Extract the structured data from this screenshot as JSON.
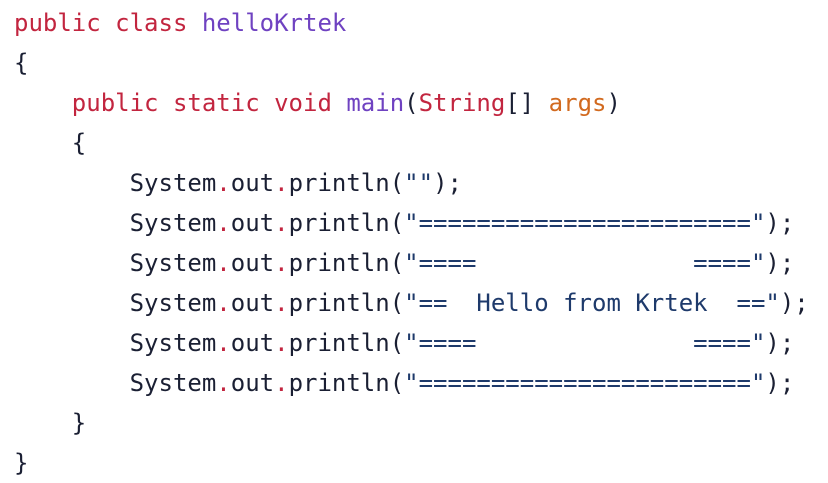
{
  "colors": {
    "background": "#ffffff",
    "keyword": "#c2253f",
    "identifier": "#6f42c1",
    "parameter": "#d26a1f",
    "text": "#1a1f33",
    "string": "#1e3a6b"
  },
  "code": {
    "language": "java",
    "lines": [
      [
        {
          "t": "keyword",
          "v": "public"
        },
        {
          "t": "plain",
          "v": " "
        },
        {
          "t": "keyword",
          "v": "class"
        },
        {
          "t": "plain",
          "v": " "
        },
        {
          "t": "classname",
          "v": "helloKrtek"
        }
      ],
      [
        {
          "t": "punct",
          "v": "{"
        }
      ],
      [
        {
          "t": "plain",
          "v": "    "
        },
        {
          "t": "keyword",
          "v": "public"
        },
        {
          "t": "plain",
          "v": " "
        },
        {
          "t": "keyword",
          "v": "static"
        },
        {
          "t": "plain",
          "v": " "
        },
        {
          "t": "keyword",
          "v": "void"
        },
        {
          "t": "plain",
          "v": " "
        },
        {
          "t": "method",
          "v": "main"
        },
        {
          "t": "punct",
          "v": "("
        },
        {
          "t": "type",
          "v": "String"
        },
        {
          "t": "punct",
          "v": "[] "
        },
        {
          "t": "param",
          "v": "args"
        },
        {
          "t": "punct",
          "v": ")"
        }
      ],
      [
        {
          "t": "plain",
          "v": "    "
        },
        {
          "t": "punct",
          "v": "{"
        }
      ],
      [
        {
          "t": "plain",
          "v": "        System"
        },
        {
          "t": "dot",
          "v": "."
        },
        {
          "t": "plain",
          "v": "out"
        },
        {
          "t": "dot",
          "v": "."
        },
        {
          "t": "plain",
          "v": "println("
        },
        {
          "t": "string",
          "v": "\"\""
        },
        {
          "t": "plain",
          "v": ");"
        }
      ],
      [
        {
          "t": "plain",
          "v": "        System"
        },
        {
          "t": "dot",
          "v": "."
        },
        {
          "t": "plain",
          "v": "out"
        },
        {
          "t": "dot",
          "v": "."
        },
        {
          "t": "plain",
          "v": "println("
        },
        {
          "t": "string",
          "v": "\"=======================\""
        },
        {
          "t": "plain",
          "v": ");"
        }
      ],
      [
        {
          "t": "plain",
          "v": "        System"
        },
        {
          "t": "dot",
          "v": "."
        },
        {
          "t": "plain",
          "v": "out"
        },
        {
          "t": "dot",
          "v": "."
        },
        {
          "t": "plain",
          "v": "println("
        },
        {
          "t": "string",
          "v": "\"====               ====\""
        },
        {
          "t": "plain",
          "v": ");"
        }
      ],
      [
        {
          "t": "plain",
          "v": "        System"
        },
        {
          "t": "dot",
          "v": "."
        },
        {
          "t": "plain",
          "v": "out"
        },
        {
          "t": "dot",
          "v": "."
        },
        {
          "t": "plain",
          "v": "println("
        },
        {
          "t": "string",
          "v": "\"==  Hello from Krtek  ==\""
        },
        {
          "t": "plain",
          "v": ");"
        }
      ],
      [
        {
          "t": "plain",
          "v": "        System"
        },
        {
          "t": "dot",
          "v": "."
        },
        {
          "t": "plain",
          "v": "out"
        },
        {
          "t": "dot",
          "v": "."
        },
        {
          "t": "plain",
          "v": "println("
        },
        {
          "t": "string",
          "v": "\"====               ====\""
        },
        {
          "t": "plain",
          "v": ");"
        }
      ],
      [
        {
          "t": "plain",
          "v": "        System"
        },
        {
          "t": "dot",
          "v": "."
        },
        {
          "t": "plain",
          "v": "out"
        },
        {
          "t": "dot",
          "v": "."
        },
        {
          "t": "plain",
          "v": "println("
        },
        {
          "t": "string",
          "v": "\"=======================\""
        },
        {
          "t": "plain",
          "v": ");"
        }
      ],
      [
        {
          "t": "plain",
          "v": "    "
        },
        {
          "t": "punct",
          "v": "}"
        }
      ],
      [
        {
          "t": "punct",
          "v": "}"
        }
      ]
    ]
  }
}
